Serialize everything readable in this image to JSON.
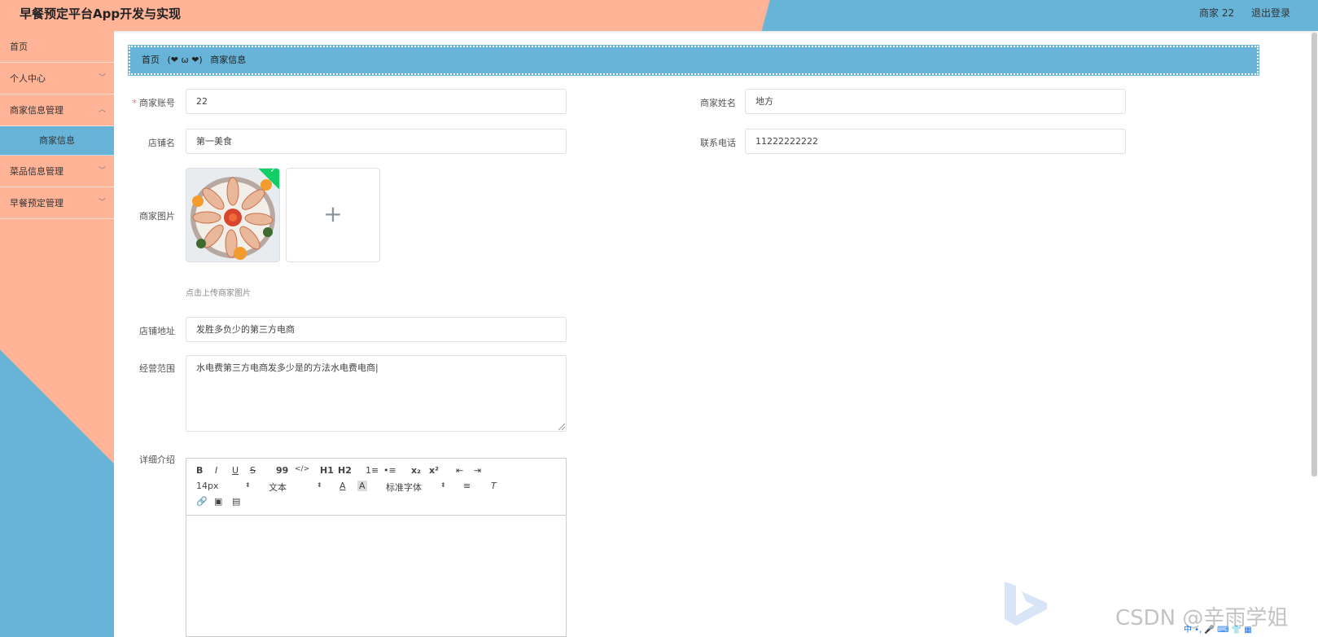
{
  "app": {
    "title": "早餐预定平台App开发与实现",
    "user": "商家 22",
    "logout": "退出登录"
  },
  "sidebar": {
    "items": [
      {
        "label": "首页"
      },
      {
        "label": "个人中心"
      },
      {
        "label": "商家信息管理"
      },
      {
        "label": "商家信息"
      },
      {
        "label": "菜品信息管理"
      },
      {
        "label": "早餐预定管理"
      }
    ]
  },
  "breadcrumb": {
    "home": "首页",
    "sep": "(❤ ω ❤)",
    "current": "商家信息"
  },
  "form": {
    "account_label": "商家账号",
    "account_value": "22",
    "name_label": "商家姓名",
    "name_value": "地方",
    "shop_label": "店铺名",
    "shop_value": "第一美食",
    "phone_label": "联系电话",
    "phone_value": "11222222222",
    "image_label": "商家图片",
    "image_tip": "点击上传商家图片",
    "upload_plus": "+",
    "address_label": "店铺地址",
    "address_value": "发胜多负少的第三方电商",
    "scope_label": "经营范围",
    "scope_value": "水电费第三方电商发多少是的方法水电费电商|",
    "detail_label": "详细介绍"
  },
  "editor": {
    "buttons": [
      "B",
      "I",
      "U",
      "S",
      "99",
      "</>",
      "H1",
      "H2",
      "1≡",
      "•≡",
      "x₂",
      "x²",
      "⇤",
      "⇥"
    ],
    "font_size": "14px",
    "text_style": "文本",
    "font_family": "标准字体"
  },
  "watermark": "CSDN @辛雨学姐",
  "tray": "中 •, 🎤 ⌨ 👕 ▦"
}
